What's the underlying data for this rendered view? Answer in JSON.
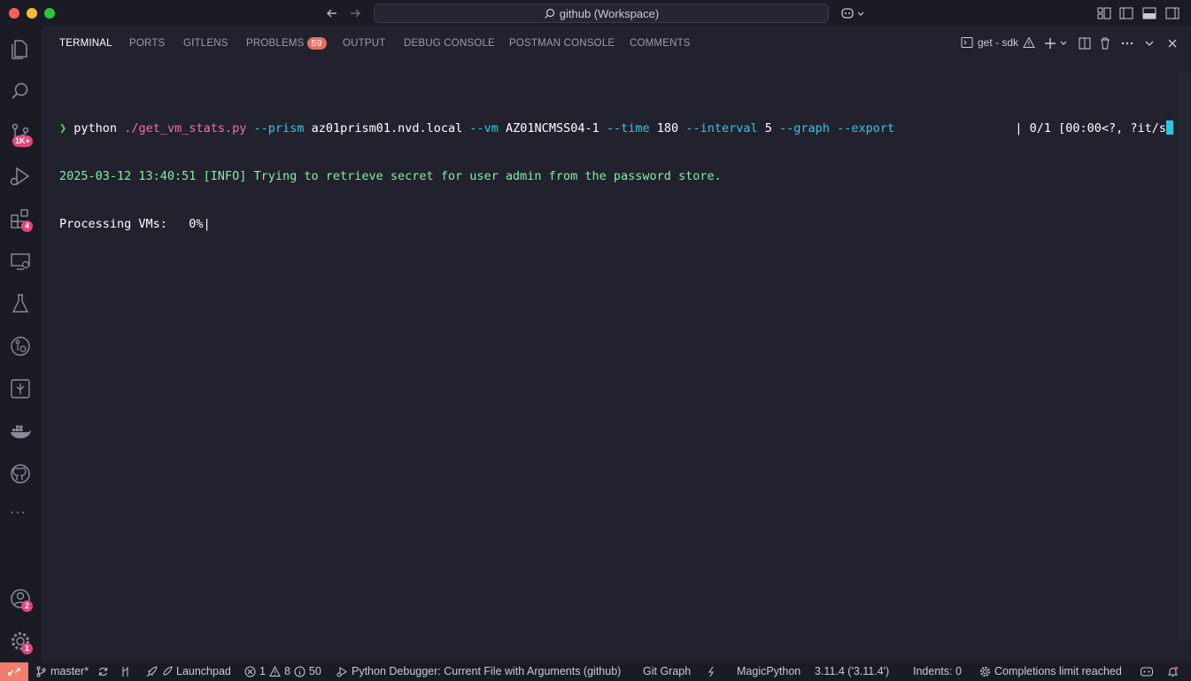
{
  "titlebar": {
    "search_text": "github (Workspace)"
  },
  "activity_bar": {
    "scm_badge": "1K+",
    "extensions_badge": "4",
    "accounts_badge": "2",
    "settings_badge": "1",
    "more_label": "···"
  },
  "panel": {
    "tabs": [
      {
        "label": "TERMINAL"
      },
      {
        "label": "PORTS"
      },
      {
        "label": "GITLENS"
      },
      {
        "label": "PROBLEMS"
      },
      {
        "label": "OUTPUT"
      },
      {
        "label": "DEBUG CONSOLE"
      },
      {
        "label": "POSTMAN CONSOLE"
      },
      {
        "label": "COMMENTS"
      }
    ],
    "problems_count": "59",
    "terminal_name": "get - sdk"
  },
  "terminal": {
    "prompt": "❯",
    "cmd_python": "python",
    "cmd_script": "./get_vm_stats.py",
    "flag_prism": "--prism",
    "val_prism": "az01prism01.nvd.local",
    "flag_vm": "--vm",
    "val_vm": "AZ01NCMSS04-1",
    "flag_time": "--time",
    "val_time": "180",
    "flag_interval": "--interval",
    "val_interval": "5",
    "flag_graph": "--graph",
    "flag_export": "--export",
    "log_line": "2025-03-12 13:40:51 [INFO] Trying to retrieve secret for user admin from the password store.",
    "progress_left": "Processing VMs:   0%|",
    "progress_right": "| 0/1 [00:00<?, ?it/s"
  },
  "statusbar": {
    "branch": "master*",
    "launchpad": "Launchpad",
    "errors": "1",
    "warnings": "8",
    "infos": "50",
    "debugger": "Python Debugger: Current File with Arguments (github)",
    "git_graph": "Git Graph",
    "magicpython": "MagicPython",
    "python_version": "3.11.4 ('3.11.4')",
    "indents": "Indents: 0",
    "completions": "Completions limit reached"
  },
  "colors": {
    "accent_badge": "#e5457a",
    "problems_badge": "#e96f63",
    "remote": "#f07d6e",
    "flag": "#35c5e0",
    "path": "#f76cb7",
    "info": "#7ff29c"
  }
}
